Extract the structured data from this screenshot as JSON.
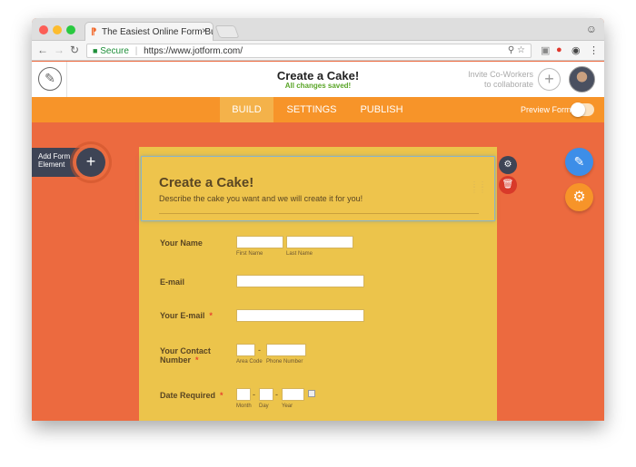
{
  "browser": {
    "tab_title": "The Easiest Online Form Build",
    "tab_close": "×",
    "secure_label": "Secure",
    "url": "https://www.jotform.com/"
  },
  "app": {
    "form_title": "Create a Cake!",
    "save_status": "All changes saved!",
    "invite_line1": "Invite Co-Workers",
    "invite_line2": "to collaborate",
    "invite_plus": "+"
  },
  "nav": {
    "tabs": [
      "BUILD",
      "SETTINGS",
      "PUBLISH"
    ],
    "active_tab": "BUILD",
    "preview_label": "Preview Form"
  },
  "builder": {
    "add_element_line1": "Add Form",
    "add_element_line2": "Element",
    "add_plus": "+"
  },
  "form": {
    "header_title": "Create a Cake!",
    "header_subtitle": "Describe the cake you want and we will create it for you!",
    "fields": {
      "name_label": "Your Name",
      "first_name": "First Name",
      "last_name": "Last Name",
      "email_label": "E-mail",
      "your_email_label": "Your E-mail",
      "contact_label_1": "Your Contact",
      "contact_label_2": "Number",
      "area_code": "Area Code",
      "phone_number": "Phone Number",
      "date_label": "Date Required",
      "month": "Month",
      "day": "Day",
      "year": "Year",
      "required_mark": "*",
      "dash": "-"
    }
  },
  "colors": {
    "canvas": "#ec6a3f",
    "nav": "#f79429",
    "form_bg": "#ecc44b",
    "accent_blue": "#3d8ee8",
    "saved_green": "#5aa528"
  }
}
